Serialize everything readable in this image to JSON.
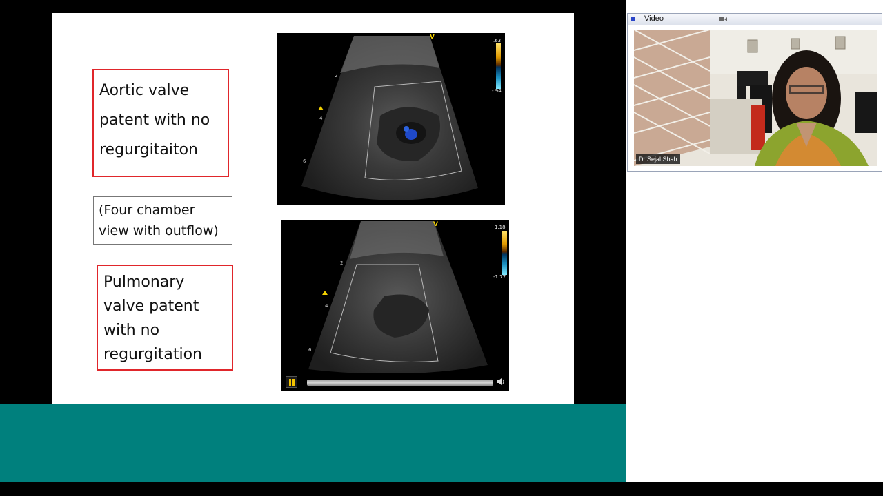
{
  "slide": {
    "box_aortic": "Aortic valve\npatent with no\nregurgitaiton",
    "box_view": "(Four chamber\nview with outflow)",
    "box_pulmonary": "Pulmonary\nvalve patent\nwith no\nregurgitation"
  },
  "ultrasound_top": {
    "scale_top": ".63",
    "scale_bottom": "-.94",
    "marker": "V",
    "depth_ticks": [
      "2",
      "4",
      "6"
    ]
  },
  "ultrasound_bottom": {
    "scale_top": "1.18",
    "scale_bottom": "-1.77",
    "marker": "V",
    "depth_ticks": [
      "2",
      "4",
      "6"
    ]
  },
  "video_window": {
    "title": "Video",
    "participant_name": "Dr Sejal Shah"
  },
  "colors": {
    "teal_bar": "#00807d",
    "box_border": "#e0262b",
    "pause_accent": "#f2c200"
  },
  "icons": {
    "pause": "pause-icon",
    "volume": "speaker-icon",
    "camera": "camera-icon"
  }
}
